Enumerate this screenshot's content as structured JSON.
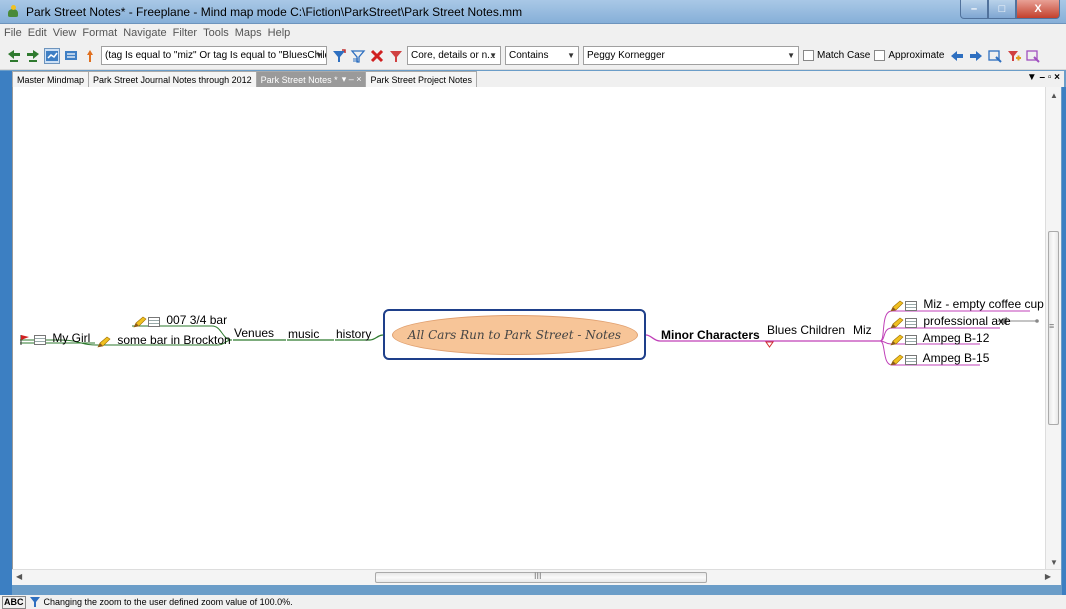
{
  "window": {
    "title": "Park Street Notes* - Freeplane - Mind map mode C:\\Fiction\\ParkStreet\\Park Street Notes.mm",
    "controls": [
      "–",
      "□",
      "X"
    ]
  },
  "menubar": [
    "File",
    "Edit",
    "View",
    "Format",
    "Navigate",
    "Filter",
    "Tools",
    "Maps",
    "Help"
  ],
  "toolbar": {
    "filter_expression": "(tag Is equal to \"miz\" Or tag Is equal to \"BluesChildren\")",
    "search_scope": "Core, details or n...",
    "condition": "Contains",
    "search_value": "Peggy Kornegger",
    "match_case_label": "Match Case",
    "approximate_label": "Approximate"
  },
  "tabs": [
    {
      "label": "Master Mindmap",
      "active": false
    },
    {
      "label": "Park Street Journal Notes through 2012",
      "active": false
    },
    {
      "label": "Park Street Notes *",
      "active": true
    },
    {
      "label": "Park Street Project Notes",
      "active": false
    }
  ],
  "tab_controls": "▼ – ▫ ×",
  "mindmap": {
    "root": "All Cars Run to Park Street - Notes",
    "left": {
      "history": "history",
      "music": "music",
      "venues": "Venues",
      "bar1": "007 3/4 bar",
      "bar2": "some bar in Brockton",
      "mygirl": "My Girl"
    },
    "right": {
      "minor": "Minor Characters",
      "blues": "Blues Children",
      "miz": "Miz",
      "leaf1": "Miz - empty coffee cup",
      "leaf2": "professional axe",
      "leaf3": "Ampeg B-12",
      "leaf4": "Ampeg B-15"
    }
  },
  "status": {
    "abc": "ABC",
    "message": "Changing the zoom to the user defined zoom value of 100.0%."
  },
  "colors": {
    "left_branch": "#2e7a2e",
    "right_branch": "#c040b8",
    "root_border": "#1e3f8a",
    "root_fill": "#f7c598"
  }
}
